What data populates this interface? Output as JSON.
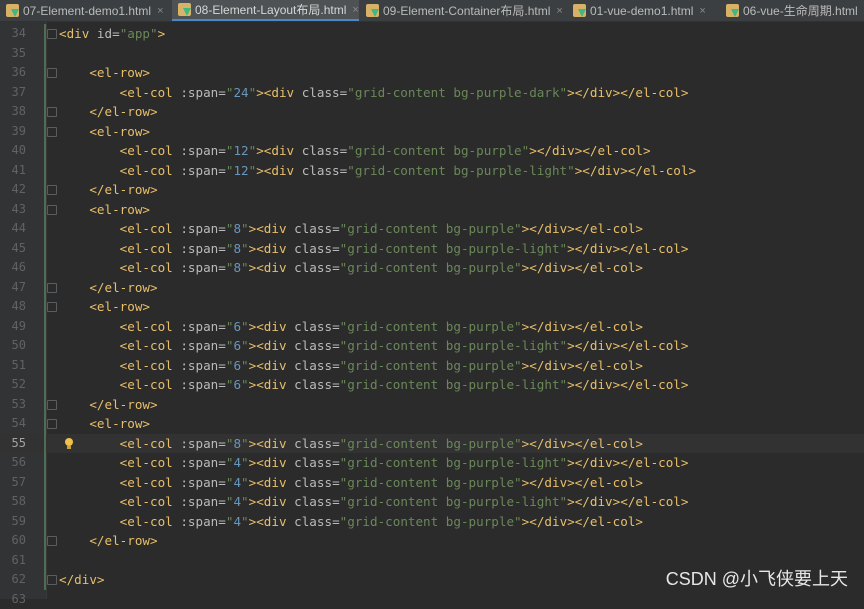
{
  "tabs": [
    {
      "label": "07-Element-demo1.html",
      "active": false
    },
    {
      "label": "08-Element-Layout布局.html",
      "active": true
    },
    {
      "label": "09-Element-Container布局.html",
      "active": false
    },
    {
      "label": "01-vue-demo1.html",
      "active": false
    },
    {
      "label": "06-vue-生命周期.html",
      "active": false
    }
  ],
  "tab_close_glyph": "×",
  "lines": [
    {
      "num": "34",
      "text": "<div id=\"app\">"
    },
    {
      "num": "35",
      "text": ""
    },
    {
      "num": "36",
      "text": "    <el-row>"
    },
    {
      "num": "37",
      "text": "        <el-col :span=\"24\"><div class=\"grid-content bg-purple-dark\"></div></el-col>"
    },
    {
      "num": "38",
      "text": "    </el-row>"
    },
    {
      "num": "39",
      "text": "    <el-row>"
    },
    {
      "num": "40",
      "text": "        <el-col :span=\"12\"><div class=\"grid-content bg-purple\"></div></el-col>"
    },
    {
      "num": "41",
      "text": "        <el-col :span=\"12\"><div class=\"grid-content bg-purple-light\"></div></el-col>"
    },
    {
      "num": "42",
      "text": "    </el-row>"
    },
    {
      "num": "43",
      "text": "    <el-row>"
    },
    {
      "num": "44",
      "text": "        <el-col :span=\"8\"><div class=\"grid-content bg-purple\"></div></el-col>"
    },
    {
      "num": "45",
      "text": "        <el-col :span=\"8\"><div class=\"grid-content bg-purple-light\"></div></el-col>"
    },
    {
      "num": "46",
      "text": "        <el-col :span=\"8\"><div class=\"grid-content bg-purple\"></div></el-col>"
    },
    {
      "num": "47",
      "text": "    </el-row>"
    },
    {
      "num": "48",
      "text": "    <el-row>"
    },
    {
      "num": "49",
      "text": "        <el-col :span=\"6\"><div class=\"grid-content bg-purple\"></div></el-col>"
    },
    {
      "num": "50",
      "text": "        <el-col :span=\"6\"><div class=\"grid-content bg-purple-light\"></div></el-col>"
    },
    {
      "num": "51",
      "text": "        <el-col :span=\"6\"><div class=\"grid-content bg-purple\"></div></el-col>"
    },
    {
      "num": "52",
      "text": "        <el-col :span=\"6\"><div class=\"grid-content bg-purple-light\"></div></el-col>"
    },
    {
      "num": "53",
      "text": "    </el-row>"
    },
    {
      "num": "54",
      "text": "    <el-row>"
    },
    {
      "num": "55",
      "text": "        <el-col :span=\"8\"><div class=\"grid-content bg-purple\"></div></el-col>"
    },
    {
      "num": "56",
      "text": "        <el-col :span=\"4\"><div class=\"grid-content bg-purple-light\"></div></el-col>"
    },
    {
      "num": "57",
      "text": "        <el-col :span=\"4\"><div class=\"grid-content bg-purple\"></div></el-col>"
    },
    {
      "num": "58",
      "text": "        <el-col :span=\"4\"><div class=\"grid-content bg-purple-light\"></div></el-col>"
    },
    {
      "num": "59",
      "text": "        <el-col :span=\"4\"><div class=\"grid-content bg-purple\"></div></el-col>"
    },
    {
      "num": "60",
      "text": "    </el-row>"
    },
    {
      "num": "61",
      "text": ""
    },
    {
      "num": "62",
      "text": "</div>"
    },
    {
      "num": "63",
      "text": ""
    }
  ],
  "current_line": "55",
  "watermark": "CSDN @小飞侠要上天",
  "colors": {
    "tag": "#e8bf6a",
    "attr": "#bababa",
    "string": "#6a8759",
    "number": "#6897bb",
    "background": "#2b2b2b"
  }
}
